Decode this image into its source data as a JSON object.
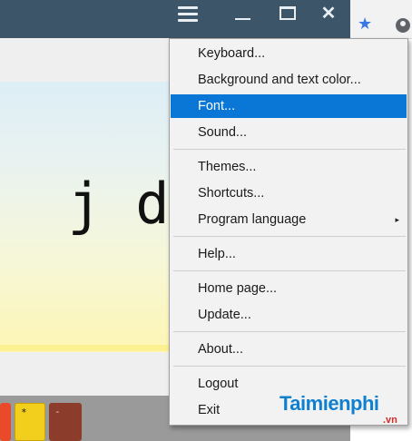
{
  "titlebar": {
    "menu_icon": "hamburger-icon",
    "minimize_icon": "minimize-icon",
    "maximize_icon": "maximize-icon",
    "close_glyph": "✕",
    "background_color": "#3c5568"
  },
  "browser": {
    "bookmark_icon": "star-icon",
    "star_glyph": "★",
    "account_icon": "account-icon"
  },
  "practice_text": "  j d",
  "keys": {
    "yellow": "*",
    "brown": "-"
  },
  "menu": {
    "items": [
      {
        "label": "Keyboard..."
      },
      {
        "label": "Background and text color..."
      },
      {
        "label": "Font...",
        "selected": true
      },
      {
        "label": "Sound..."
      },
      {
        "label": "Themes..."
      },
      {
        "label": "Shortcuts..."
      },
      {
        "label": "Program language",
        "submenu": true,
        "arrow": "▸"
      },
      {
        "label": "Help..."
      },
      {
        "label": "Home page..."
      },
      {
        "label": "Update..."
      },
      {
        "label": "About..."
      },
      {
        "label": "Logout"
      },
      {
        "label": "Exit"
      }
    ],
    "selected_color": "#0a77d7"
  },
  "watermark": {
    "main": "Taimienphi",
    "suffix": ".vn"
  }
}
